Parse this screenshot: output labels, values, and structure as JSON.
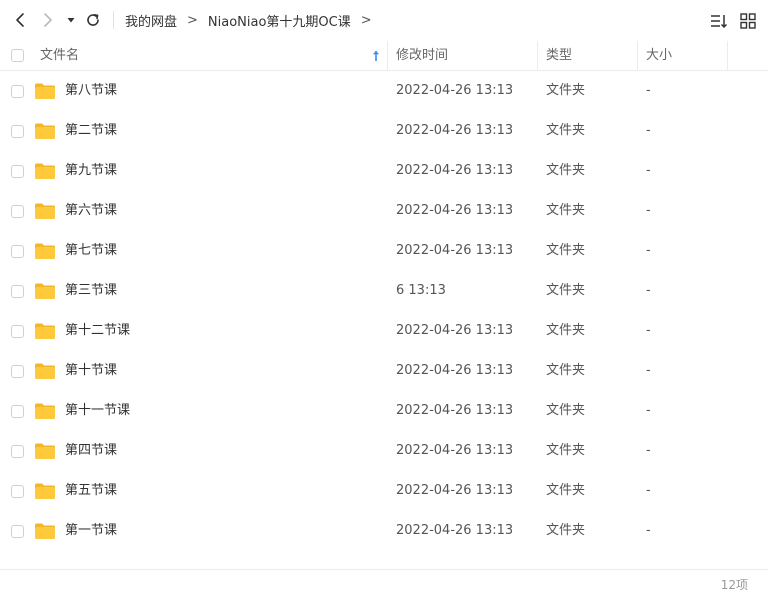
{
  "toolbar": {
    "breadcrumb": [
      "我的网盘",
      "NiaoNiao第十九期OC课"
    ],
    "separator": ">"
  },
  "header": {
    "name": "文件名",
    "modified": "修改时间",
    "type": "类型",
    "size": "大小"
  },
  "rows": [
    {
      "name": "第八节课",
      "time": "2022-04-26 13:13",
      "type": "文件夹",
      "size": "-"
    },
    {
      "name": "第二节课",
      "time": "2022-04-26 13:13",
      "type": "文件夹",
      "size": "-"
    },
    {
      "name": "第九节课",
      "time": "2022-04-26 13:13",
      "type": "文件夹",
      "size": "-"
    },
    {
      "name": "第六节课",
      "time": "2022-04-26 13:13",
      "type": "文件夹",
      "size": "-"
    },
    {
      "name": "第七节课",
      "time": "2022-04-26 13:13",
      "type": "文件夹",
      "size": "-"
    },
    {
      "name": "第三节课",
      "time": "6 13:13",
      "type": "文件夹",
      "size": "-"
    },
    {
      "name": "第十二节课",
      "time": "2022-04-26 13:13",
      "type": "文件夹",
      "size": "-"
    },
    {
      "name": "第十节课",
      "time": "2022-04-26 13:13",
      "type": "文件夹",
      "size": "-"
    },
    {
      "name": "第十一节课",
      "time": "2022-04-26 13:13",
      "type": "文件夹",
      "size": "-"
    },
    {
      "name": "第四节课",
      "time": "2022-04-26 13:13",
      "type": "文件夹",
      "size": "-"
    },
    {
      "name": "第五节课",
      "time": "2022-04-26 13:13",
      "type": "文件夹",
      "size": "-"
    },
    {
      "name": "第一节课",
      "time": "2022-04-26 13:13",
      "type": "文件夹",
      "size": "-"
    }
  ],
  "footer": {
    "count": "12项"
  },
  "colors": {
    "folder": "#ffc93c",
    "folder_tab": "#f2b62c",
    "sort_arrow": "#3b8cf6"
  },
  "icons": {
    "back": "chevron-left-icon",
    "forward": "chevron-right-icon",
    "history": "caret-down-icon",
    "refresh": "refresh-icon",
    "sort": "sort-icon",
    "view": "grid-view-icon",
    "folder": "folder-icon"
  }
}
